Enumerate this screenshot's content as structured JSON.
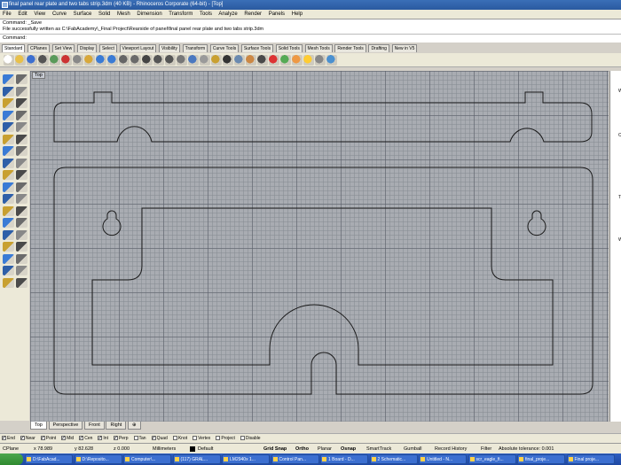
{
  "window": {
    "title": "final panel rear plate and two tabs strip.3dm (40 KB) - Rhinoceros Corporate (64-bit) - [Top]"
  },
  "menu": [
    "File",
    "Edit",
    "View",
    "Curve",
    "Surface",
    "Solid",
    "Mesh",
    "Dimension",
    "Transform",
    "Tools",
    "Analyze",
    "Render",
    "Panels",
    "Help"
  ],
  "command_history": [
    "Command: _Save",
    "File successfully written as C:\\FabAcademy\\_Final Project\\Rearside of panel\\final panel rear plate and two tabs strip.3dm"
  ],
  "command_prompt": "Command:",
  "toolbar_tabs": [
    "Standard",
    "CPlanes",
    "Set View",
    "Display",
    "Select",
    "Viewport Layout",
    "Visibility",
    "Transform",
    "Curve Tools",
    "Surface Tools",
    "Solid Tools",
    "Mesh Tools",
    "Render Tools",
    "Drafting",
    "New in V5"
  ],
  "toolbar_icons": [
    "new-file-icon",
    "open-icon",
    "save-icon",
    "print-icon",
    "import-icon",
    "cut-icon",
    "copy-icon",
    "paste-icon",
    "undo-icon",
    "redo-icon",
    "pan-icon",
    "rotate-view-icon",
    "zoom-icon",
    "zoom-window-icon",
    "zoom-extents-icon",
    "zoom-selected-icon",
    "four-views-icon",
    "display-mode-icon",
    "lock-icon",
    "points-icon",
    "grid-icon",
    "layer-icon",
    "object-props-icon",
    "render-sphere-icon",
    "material-icon",
    "environment-icon",
    "light-icon",
    "options-icon",
    "help-icon"
  ],
  "viewport": {
    "label": "Top"
  },
  "viewport_tabs": [
    "Top",
    "Perspective",
    "Front",
    "Right",
    "⊕"
  ],
  "osnaps": [
    {
      "label": "End",
      "checked": true
    },
    {
      "label": "Near",
      "checked": true
    },
    {
      "label": "Point",
      "checked": true
    },
    {
      "label": "Mid",
      "checked": true
    },
    {
      "label": "Cen",
      "checked": true
    },
    {
      "label": "Int",
      "checked": true
    },
    {
      "label": "Perp",
      "checked": true
    },
    {
      "label": "Tan",
      "checked": false
    },
    {
      "label": "Quad",
      "checked": true
    },
    {
      "label": "Knot",
      "checked": false
    },
    {
      "label": "Vertex",
      "checked": false
    },
    {
      "label": "Project",
      "checked": false
    },
    {
      "label": "Disable",
      "checked": false
    }
  ],
  "status": {
    "cplane": "CPlane",
    "x": "x 78.989",
    "y": "y 82.628",
    "z": "z 0.000",
    "units": "Millimeters",
    "layer": "Default",
    "grid_snap": "Grid Snap",
    "ortho": "Ortho",
    "planar": "Planar",
    "osnap": "Osnap",
    "smarttrack": "SmartTrack",
    "gumball": "Gumball",
    "record_history": "Record History",
    "filter": "Filter",
    "tolerance": "Absolute tolerance: 0.001"
  },
  "taskbar": [
    "D:\\FabAcad...",
    "D:\\Reposito...",
    "Computer\\...",
    "(117) GRAL...",
    "LM2940x 1...",
    "Control Pan...",
    "1 Board - D...",
    "2 Schematic...",
    "Untitled - N...",
    "scr_eagle_fi...",
    "final_proje...",
    "Final proje..."
  ],
  "right_panel_letters": [
    "W",
    "C",
    "T",
    "W"
  ]
}
